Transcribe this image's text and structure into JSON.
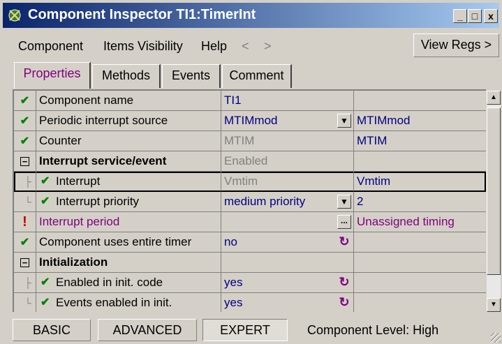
{
  "window": {
    "title": "Component Inspector TI1:TimerInt",
    "buttons": {
      "minimize": "_",
      "maximize": "□",
      "close": "x"
    }
  },
  "menu": {
    "component": "Component",
    "items_visibility": "Items Visibility",
    "help": "Help",
    "back": "<",
    "forward": ">",
    "view_regs": "View Regs >"
  },
  "tabs": [
    {
      "label": "Properties",
      "active": true
    },
    {
      "label": "Methods",
      "active": false
    },
    {
      "label": "Events",
      "active": false
    },
    {
      "label": "Comment",
      "active": false
    }
  ],
  "properties": {
    "rows": [
      {
        "name": "Component name",
        "value": "TI1",
        "extra": ""
      },
      {
        "name": "Periodic interrupt source",
        "value": "MTIMmod",
        "extra": "MTIMmod"
      },
      {
        "name": "Counter",
        "value": "MTIM",
        "extra": "MTIM"
      },
      {
        "name": "Interrupt service/event",
        "value": "Enabled",
        "extra": ""
      },
      {
        "name": "Interrupt",
        "value": "Vmtim",
        "extra": "Vmtim"
      },
      {
        "name": "Interrupt priority",
        "value": "medium priority",
        "extra": "2"
      },
      {
        "name": "Interrupt period",
        "value": "",
        "extra": "Unassigned timing"
      },
      {
        "name": "Component uses entire timer",
        "value": "no",
        "extra": ""
      },
      {
        "name": "Initialization",
        "value": "",
        "extra": ""
      },
      {
        "name": "Enabled in init. code",
        "value": "yes",
        "extra": ""
      },
      {
        "name": "Events enabled in init.",
        "value": "yes",
        "extra": ""
      }
    ]
  },
  "footer": {
    "basic": "BASIC",
    "advanced": "ADVANCED",
    "expert": "EXPERT",
    "level_text": "Component Level: High"
  },
  "colors": {
    "title_gradient_start": "#0a246a",
    "title_gradient_end": "#a6caf0",
    "window_bg": "#d4d0c8",
    "value_text": "#000080",
    "error_text": "#800080",
    "ok_check": "#008000",
    "error_mark": "#c00000"
  }
}
